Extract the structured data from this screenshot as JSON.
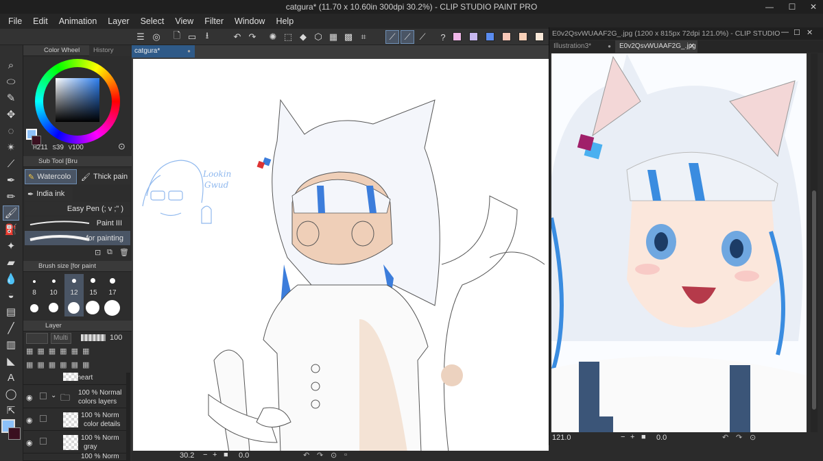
{
  "window": {
    "title": "catgura* (11.70 x 10.60in 300dpi 30.2%)  - CLIP STUDIO PAINT PRO",
    "minimize": "—",
    "maximize": "☐",
    "close": "✕"
  },
  "menu": [
    "File",
    "Edit",
    "Animation",
    "Layer",
    "Select",
    "View",
    "Filter",
    "Window",
    "Help"
  ],
  "command_bar": {
    "swatch_colors": [
      "#f0b8e8",
      "#c8b8f0",
      "#5a8cf0",
      "#f8c8b8",
      "#f8d0b8",
      "#f8e8d8",
      "#58c8f8"
    ]
  },
  "colors": {
    "accent": "#6e8fb5",
    "active_tab": "#2f5a88",
    "main_color": "#8cc0f8",
    "sub_color": "#3a1020",
    "sketch_blue": "#8fb8ee"
  },
  "color_panel": {
    "tab_label": "Color Wheel",
    "tab2_label": "History",
    "h": "211",
    "s": "39",
    "v": "100"
  },
  "subtool_panel": {
    "title": "Sub Tool [Bru",
    "tabs": [
      {
        "label": "Watercolo",
        "active": true
      },
      {
        "label": "Thick pain",
        "active": false
      },
      {
        "label": "India ink",
        "active": false
      }
    ],
    "brushes": [
      {
        "label": "Easy Pen (; v ;\" )",
        "active": false
      },
      {
        "label": "Paint III",
        "active": false
      },
      {
        "label": "for painting",
        "active": true
      }
    ]
  },
  "brush_size_panel": {
    "title": "Brush size [for paint",
    "sizes": [
      "8",
      "10",
      "12",
      "15",
      "17"
    ],
    "selected": "12"
  },
  "layer_panel": {
    "title": "Layer",
    "blend_mode": "Multi",
    "opacity": "100",
    "layers": [
      {
        "line1": "lineart",
        "line2": ""
      },
      {
        "line1": "100 % Normal",
        "line2": "colors layers",
        "folder": true
      },
      {
        "line1": "100 % Norm",
        "line2": "color details"
      },
      {
        "line1": "100 % Norm",
        "line2": "gray"
      },
      {
        "line1": "100 % Norm",
        "line2": ""
      }
    ]
  },
  "document": {
    "tab_label": "catgura*",
    "zoom": "30.2",
    "rotation": "0.0",
    "sketch_text_line1": "Lookin",
    "sketch_text_line2": "Gwud"
  },
  "reference_window": {
    "title": "E0v2QsvWUAAF2G_.jpg (1200 x 815px 72dpi 121.0%)  - CLIP STUDIO",
    "tabs": [
      {
        "label": "Illustration3*",
        "active": false
      },
      {
        "label": "E0v2QsvWUAAF2G_.jpg",
        "active": true
      }
    ],
    "zoom": "121.0",
    "rotation": "0.0"
  }
}
